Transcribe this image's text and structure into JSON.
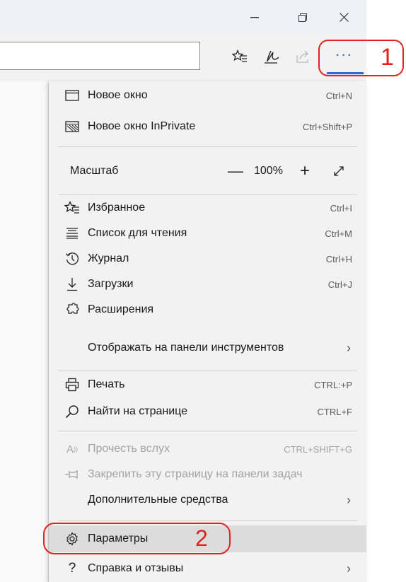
{
  "menu": {
    "new_window": {
      "label": "Новое окно",
      "shortcut": "Ctrl+N"
    },
    "new_private": {
      "label": "Новое окно InPrivate",
      "shortcut": "Ctrl+Shift+P"
    },
    "zoom": {
      "label": "Масштаб",
      "minus": "—",
      "value": "100%",
      "plus": "+"
    },
    "favorites": {
      "label": "Избранное",
      "shortcut": "Ctrl+I"
    },
    "reading_list": {
      "label": "Список для чтения",
      "shortcut": "Ctrl+M"
    },
    "history": {
      "label": "Журнал",
      "shortcut": "Ctrl+H"
    },
    "downloads": {
      "label": "Загрузки",
      "shortcut": "Ctrl+J"
    },
    "extensions": {
      "label": "Расширения"
    },
    "show_in_toolbar": {
      "label": "Отображать на панели инструментов"
    },
    "print": {
      "label": "Печать",
      "shortcut": "CTRL:+P"
    },
    "find": {
      "label": "Найти на странице",
      "shortcut": "CTRL+F"
    },
    "read_aloud": {
      "label": "Прочесть вслух",
      "shortcut": "CTRL+SHIFT+G"
    },
    "pin_taskbar": {
      "label": "Закрепить эту страницу на панели задач"
    },
    "more_tools": {
      "label": "Дополнительные средства"
    },
    "settings": {
      "label": "Параметры"
    },
    "help": {
      "label": "Справка и отзывы"
    }
  },
  "toolbar": {
    "more_label": "···"
  },
  "annotations": {
    "step1": "1",
    "step2": "2"
  },
  "colors": {
    "accent": "#1e6fd9",
    "annotation": "#e0231e",
    "menu_bg": "#f2f2f2",
    "highlight": "#dcdcdc"
  },
  "icons": [
    "minimize-icon",
    "restore-icon",
    "close-icon",
    "favorites-hub-icon",
    "pen-icon",
    "share-icon",
    "more-icon",
    "window-icon",
    "private-window-icon",
    "fullscreen-icon",
    "star-list-icon",
    "reading-list-icon",
    "history-icon",
    "download-icon",
    "extensions-icon",
    "print-icon",
    "search-icon",
    "read-aloud-icon",
    "pin-icon",
    "gear-icon",
    "help-icon"
  ]
}
